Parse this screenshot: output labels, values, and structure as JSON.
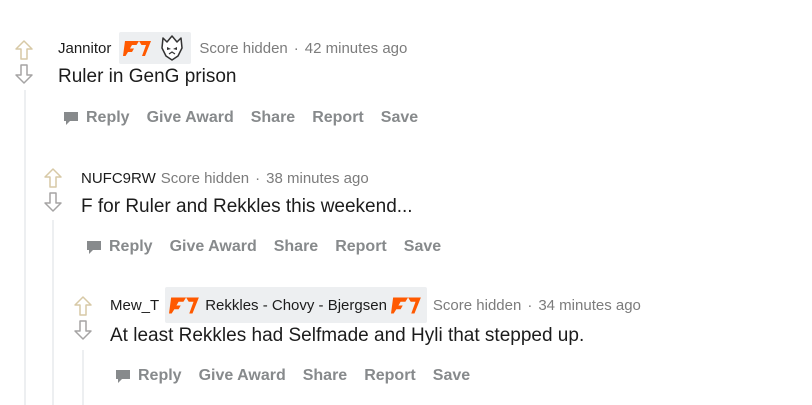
{
  "comments": [
    {
      "author": "Jannitor",
      "flair_icons": [
        "fnatic-logo-icon",
        "g2-logo-icon"
      ],
      "score": "Score hidden",
      "separator": "·",
      "time": "42 minutes ago",
      "body": "Ruler in GenG prison"
    },
    {
      "author": "NUFC9RW",
      "score": "Score hidden",
      "separator": "·",
      "time": "38 minutes ago",
      "body": "F for Ruler and Rekkles this weekend..."
    },
    {
      "author": "Mew_T",
      "flair_text": "Rekkles - Chovy - Bjergsen",
      "flair_icons": [
        "fnatic-logo-icon",
        "fnatic-logo-icon"
      ],
      "score": "Score hidden",
      "separator": "·",
      "time": "34 minutes ago",
      "body": "At least Rekkles had Selfmade and Hyli that stepped up."
    }
  ],
  "actions": {
    "reply": "Reply",
    "give_award": "Give Award",
    "share": "Share",
    "report": "Report",
    "save": "Save"
  },
  "colors": {
    "fnatic_orange": "#ff5900",
    "muted_text": "#7c7c7c",
    "action_text": "#878a8c",
    "thread_line": "#edeff1",
    "upvote_outline": "#d7c9a6",
    "downvote_outline": "#a5a4a4"
  }
}
